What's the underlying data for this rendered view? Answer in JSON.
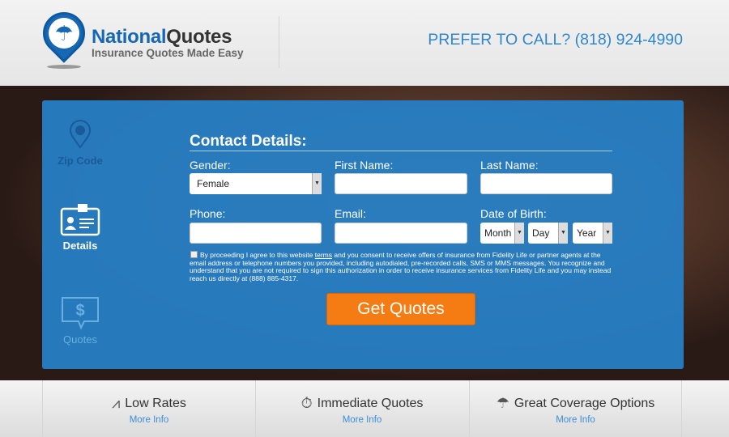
{
  "header": {
    "brand_part1": "National",
    "brand_part2": "Quotes",
    "tagline": "Insurance Quotes Made Easy",
    "phone": "PREFER TO CALL? (818) 924-4990"
  },
  "steps": [
    {
      "label": "Zip Code"
    },
    {
      "label": "Details"
    },
    {
      "label": "Quotes"
    }
  ],
  "form": {
    "title": "Contact Details:",
    "gender_label": "Gender:",
    "gender_value": "Female",
    "first_name_label": "First Name:",
    "last_name_label": "Last Name:",
    "phone_label": "Phone:",
    "email_label": "Email:",
    "dob_label": "Date of Birth:",
    "month": "Month",
    "day": "Day",
    "year": "Year",
    "legal_pre": "By proceeding I agree to this website ",
    "legal_link": "terms",
    "legal_post": " and you consent to receive offers of insurance from Fidelity Life or partner agents at the email address or telephone numbers you provided, including autodialed, pre-recorded calls, SMS or MMS messages. You recognize and understand that you are not required to sign this authorization in order to receive insurance services from Fidelity Life and you may instead reach us directly at (888) 885-4317.",
    "submit": "Get Quotes"
  },
  "features": [
    {
      "title": "Low Rates",
      "link": "More Info"
    },
    {
      "title": "Immediate Quotes",
      "link": "More Info"
    },
    {
      "title": "Great Coverage Options",
      "link": "More Info"
    }
  ],
  "colors": {
    "brand": "#1668b4",
    "panel": "#267ec4",
    "cta": "#f57c12",
    "link": "#3b8fd6"
  }
}
